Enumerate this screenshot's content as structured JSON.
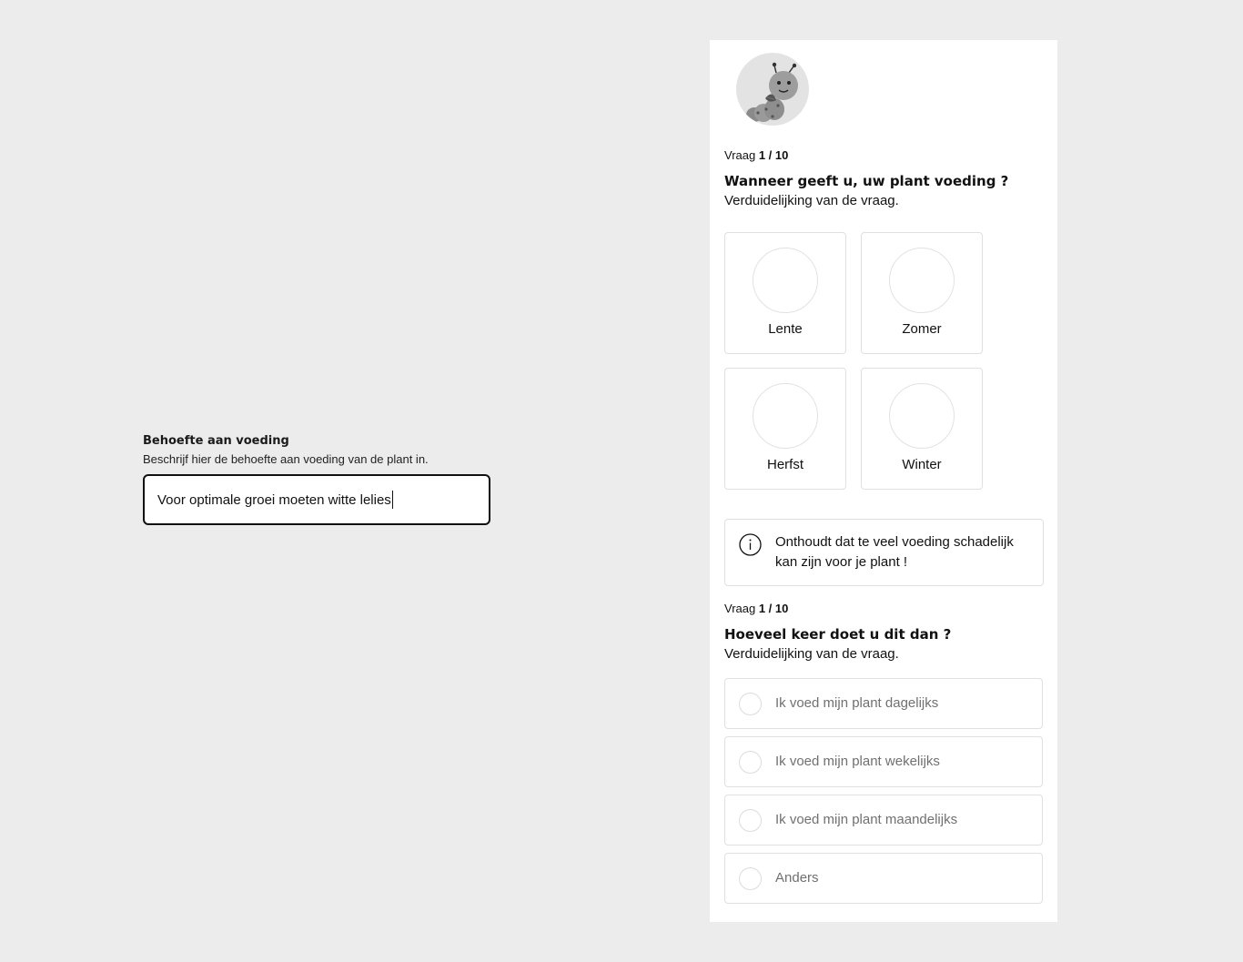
{
  "field": {
    "label": "Behoefte aan voeding",
    "help": "Beschrijf hier de behoefte aan voeding van de plant in.",
    "value": "Voor optimale groei moeten witte lelies"
  },
  "question1": {
    "counter_prefix": "Vraag ",
    "counter_value": "1 / 10",
    "title": "Wanneer geeft u, uw plant voeding ?",
    "subtitle": "Verduidelijking van de vraag.",
    "options": [
      {
        "label": "Lente"
      },
      {
        "label": "Zomer"
      },
      {
        "label": "Herfst"
      },
      {
        "label": "Winter"
      }
    ]
  },
  "info": {
    "icon": "info-icon",
    "text": "Onthoudt dat te veel voeding schadelijk kan zijn voor je plant !"
  },
  "question2": {
    "counter_prefix": "Vraag ",
    "counter_value": "1 / 10",
    "title": "Hoeveel keer doet u dit dan ?",
    "subtitle": "Verduidelijking van de vraag.",
    "options": [
      {
        "label": "Ik voed mijn plant dagelijks"
      },
      {
        "label": "Ik voed mijn plant wekelijks"
      },
      {
        "label": "Ik voed mijn plant maandelijks"
      },
      {
        "label": "Anders"
      }
    ]
  }
}
